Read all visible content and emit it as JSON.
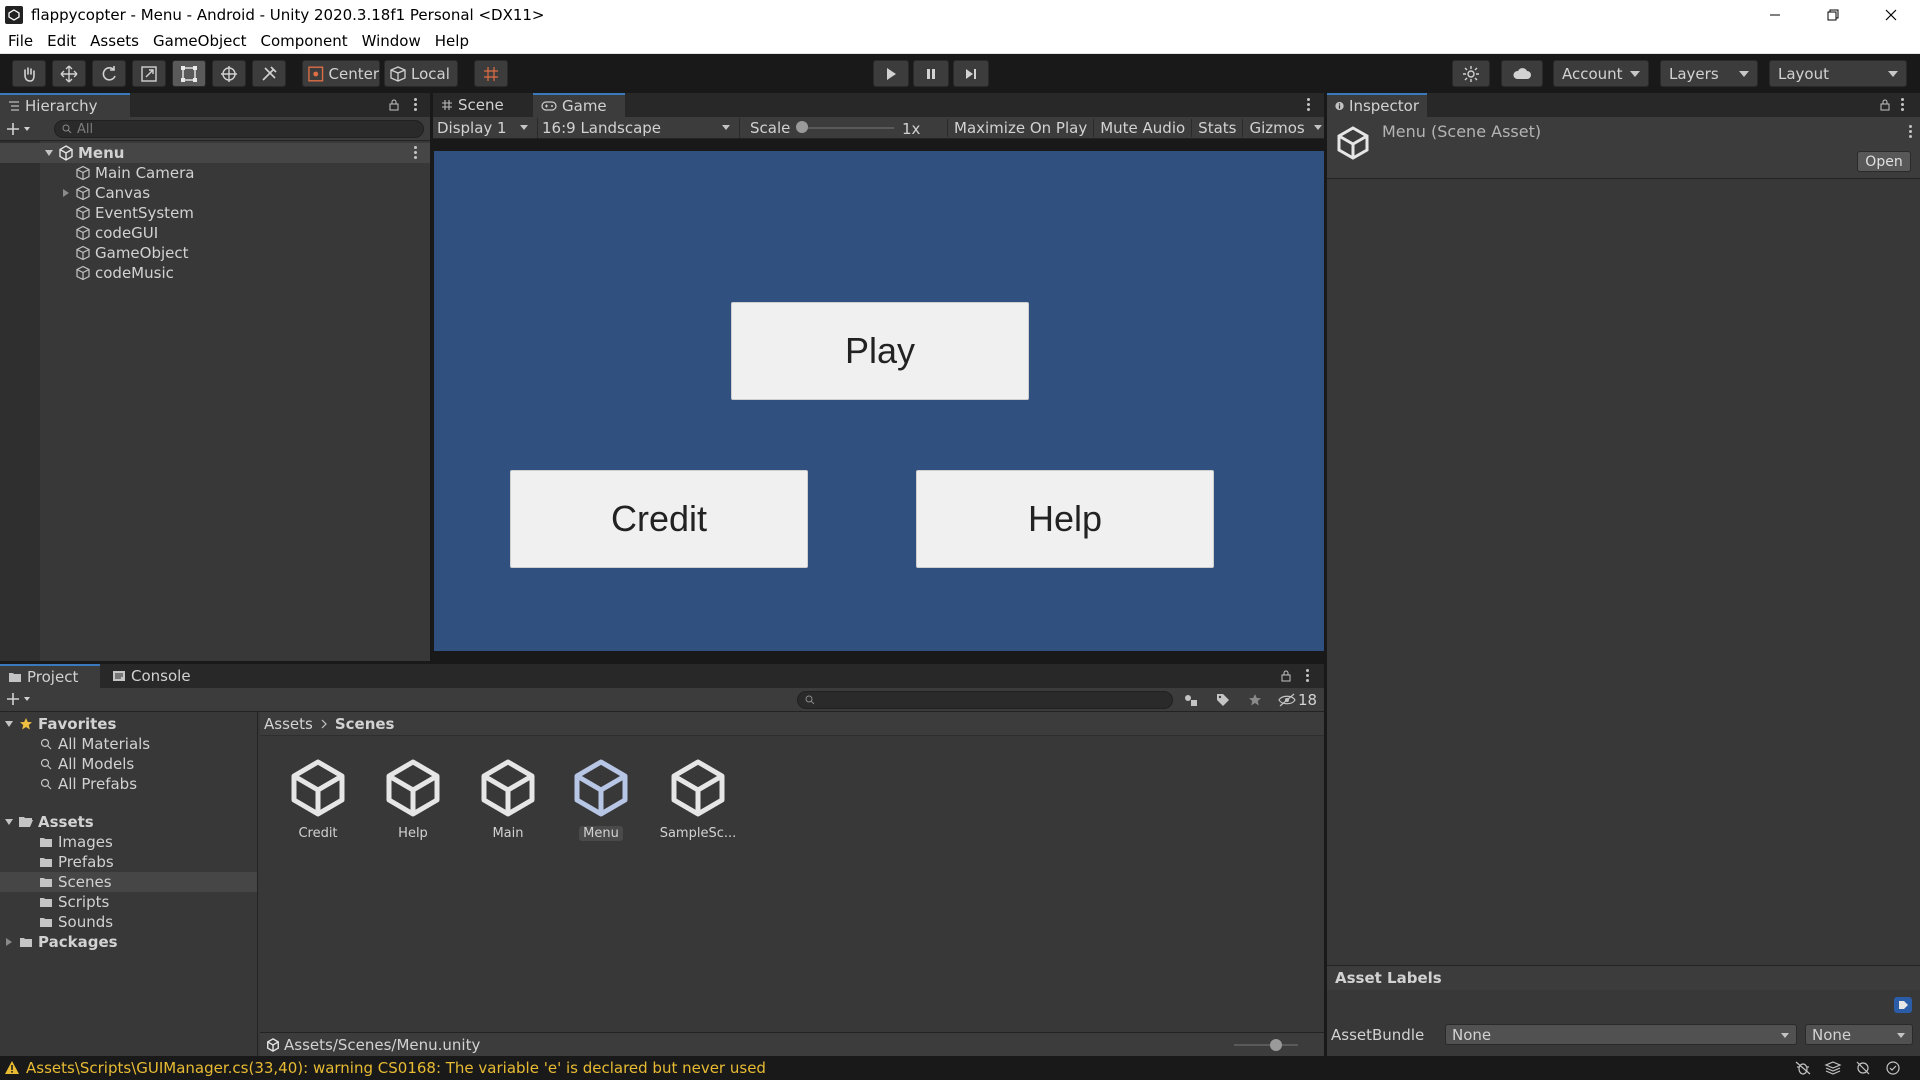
{
  "window": {
    "title": "flappycopter - Menu - Android - Unity 2020.3.18f1 Personal <DX11>"
  },
  "menubar": [
    "File",
    "Edit",
    "Assets",
    "GameObject",
    "Component",
    "Window",
    "Help"
  ],
  "toolbar": {
    "pivot": "Center",
    "space": "Local",
    "account": "Account",
    "layers": "Layers",
    "layout": "Layout"
  },
  "hierarchy": {
    "tab": "Hierarchy",
    "search_placeholder": "All",
    "scene": "Menu",
    "items": [
      "Main Camera",
      "Canvas",
      "EventSystem",
      "codeGUI",
      "GameObject",
      "codeMusic"
    ]
  },
  "game": {
    "tabs": [
      "Scene",
      "Game"
    ],
    "display": "Display 1",
    "aspect": "16:9 Landscape",
    "scale_label": "Scale",
    "scale_value": "1x",
    "toggles": [
      "Maximize On Play",
      "Mute Audio",
      "Stats",
      "Gizmos"
    ],
    "background": "#30507f",
    "buttons": {
      "play": "Play",
      "credit": "Credit",
      "help": "Help"
    }
  },
  "inspector": {
    "tab": "Inspector",
    "asset_title": "Menu (Scene Asset)",
    "open_button": "Open",
    "asset_labels": "Asset Labels",
    "assetbundle_label": "AssetBundle",
    "bundle_value": "None",
    "variant_value": "None"
  },
  "project": {
    "tabs": [
      "Project",
      "Console"
    ],
    "hidden_count": "18",
    "favorites_label": "Favorites",
    "favorites": [
      "All Materials",
      "All Models",
      "All Prefabs"
    ],
    "assets_label": "Assets",
    "folders": [
      "Images",
      "Prefabs",
      "Scenes",
      "Scripts",
      "Sounds"
    ],
    "packages_label": "Packages",
    "breadcrumb": [
      "Assets",
      "Scenes"
    ],
    "scene_assets": [
      "Credit",
      "Help",
      "Main",
      "Menu",
      "SampleSc..."
    ],
    "selected_asset": "Menu",
    "footer_path": "Assets/Scenes/Menu.unity"
  },
  "status": {
    "message": "Assets\\Scripts\\GUIManager.cs(33,40): warning CS0168: The variable 'e' is declared but never used"
  },
  "colors": {
    "accent": "#3a79bb",
    "warning": "#e8bb33",
    "game_bg": "#30507f"
  }
}
